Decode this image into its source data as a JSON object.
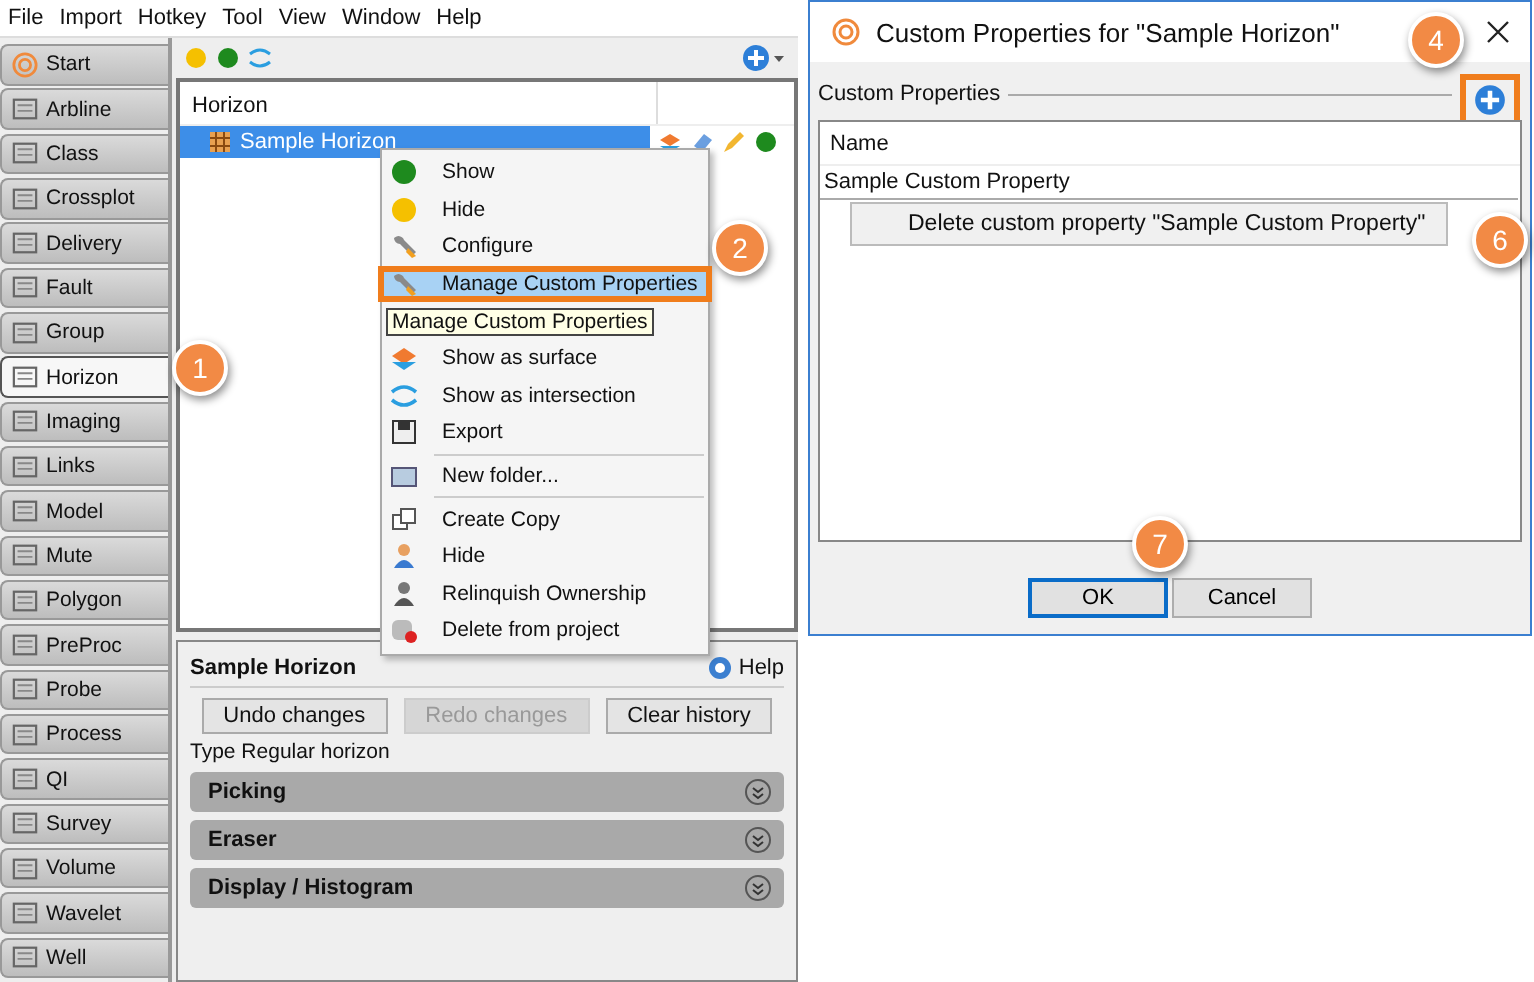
{
  "menu_bar": [
    "File",
    "Import",
    "Hotkey",
    "Tool",
    "View",
    "Window",
    "Help"
  ],
  "sidebar": {
    "tabs": [
      {
        "label": "Start",
        "selected": false
      },
      {
        "label": "Arbline",
        "selected": false
      },
      {
        "label": "Class",
        "selected": false
      },
      {
        "label": "Crossplot",
        "selected": false
      },
      {
        "label": "Delivery",
        "selected": false
      },
      {
        "label": "Fault",
        "selected": false
      },
      {
        "label": "Group",
        "selected": false
      },
      {
        "label": "Horizon",
        "selected": true
      },
      {
        "label": "Imaging",
        "selected": false
      },
      {
        "label": "Links",
        "selected": false
      },
      {
        "label": "Model",
        "selected": false
      },
      {
        "label": "Mute",
        "selected": false
      },
      {
        "label": "Polygon",
        "selected": false
      },
      {
        "label": "PreProc",
        "selected": false
      },
      {
        "label": "Probe",
        "selected": false
      },
      {
        "label": "Process",
        "selected": false
      },
      {
        "label": "QI",
        "selected": false
      },
      {
        "label": "Survey",
        "selected": false
      },
      {
        "label": "Volume",
        "selected": false
      },
      {
        "label": "Wavelet",
        "selected": false
      },
      {
        "label": "Well",
        "selected": false
      }
    ]
  },
  "tree": {
    "column": "Horizon",
    "rows": [
      {
        "label": "Sample Horizon",
        "selected": true
      }
    ]
  },
  "context_menu": {
    "groups": [
      [
        {
          "label": "Show",
          "selected": false
        },
        {
          "label": "Hide",
          "selected": false
        },
        {
          "label": "Configure",
          "selected": false
        },
        {
          "label": "Manage Custom Properties",
          "selected": true
        },
        {
          "label": "Show as surface",
          "selected": false
        },
        {
          "label": "Show as intersection",
          "selected": false
        },
        {
          "label": "Export",
          "selected": false
        }
      ],
      [
        {
          "label": "New folder...",
          "selected": false
        }
      ],
      [
        {
          "label": "Create Copy",
          "selected": false
        },
        {
          "label": "Hide",
          "selected": false
        },
        {
          "label": "Relinquish Ownership",
          "selected": false
        },
        {
          "label": "Delete from project",
          "selected": false
        }
      ]
    ],
    "tooltip": "Manage Custom Properties"
  },
  "details": {
    "title": "Sample Horizon",
    "help": "Help",
    "buttons": [
      {
        "label": "Undo changes",
        "disabled": false
      },
      {
        "label": "Redo changes",
        "disabled": true
      },
      {
        "label": "Clear history",
        "disabled": false
      }
    ],
    "type_line": "Type Regular horizon",
    "sections": [
      "Picking",
      "Eraser",
      "Display / Histogram"
    ]
  },
  "dialog": {
    "title": "Custom Properties for \"Sample Horizon\"",
    "group": "Custom Properties",
    "table": {
      "column": "Name",
      "rows": [
        "Sample Custom Property"
      ]
    },
    "popup": "Delete custom property \"Sample Custom Property\"",
    "buttons": [
      {
        "label": "OK",
        "focused": true
      },
      {
        "label": "Cancel",
        "focused": false
      }
    ]
  },
  "callouts": [
    "1",
    "2",
    "4",
    "6",
    "7"
  ]
}
